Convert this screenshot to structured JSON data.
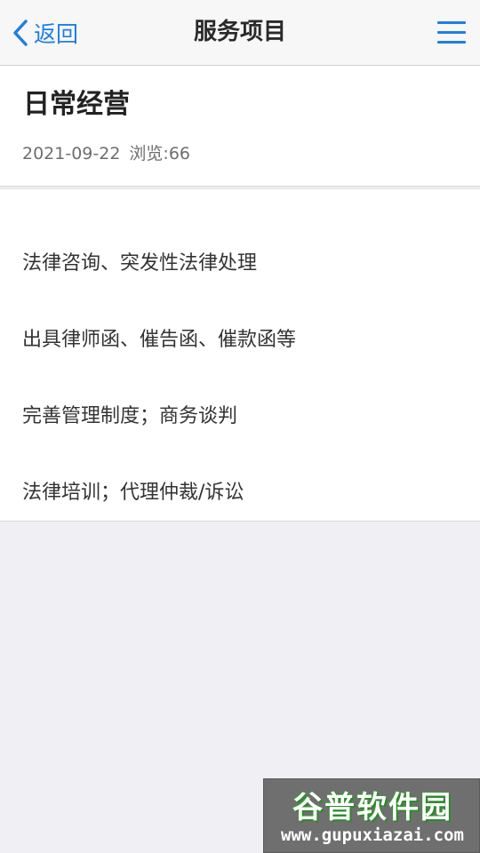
{
  "nav": {
    "back_label": "返回",
    "title": "服务项目",
    "menu_icon": "hamburger-menu-icon",
    "back_icon": "chevron-left-icon",
    "accent_color": "#1e7fe0"
  },
  "article": {
    "title": "日常经营",
    "date": "2021-09-22",
    "views": "浏览:66"
  },
  "content": {
    "lines": [
      "法律咨询、突发性法律处理",
      "出具律师函、催告函、催款函等",
      "完善管理制度；商务谈判",
      "法律培训；代理仲裁/诉讼"
    ]
  },
  "watermark": {
    "name": "谷普软件园",
    "url": "www.gupuxiazai.com"
  }
}
